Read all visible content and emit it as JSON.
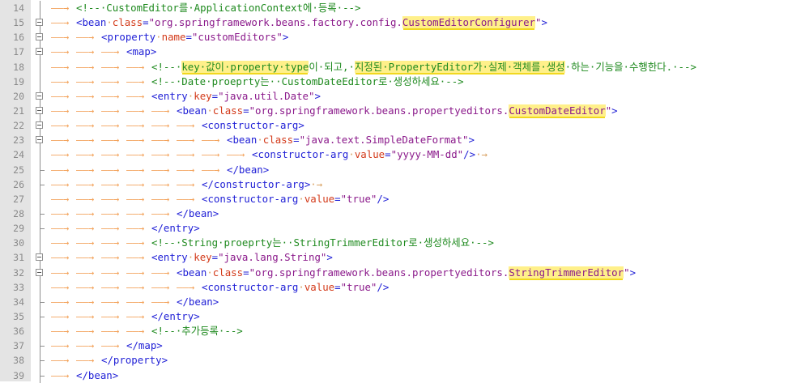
{
  "editor": {
    "lines": [
      {
        "num": "14",
        "fold": "line",
        "tabs": 1,
        "tokens": [
          {
            "t": "<!--",
            "c": "cmt"
          },
          {
            "t": "·CustomEditor를·ApplicationContext에·등록·",
            "c": "cmt"
          },
          {
            "t": "-->",
            "c": "cmt"
          }
        ]
      },
      {
        "num": "15",
        "fold": "box",
        "tabs": 1,
        "tokens": [
          {
            "t": "<bean",
            "c": "tag"
          },
          {
            "t": "·",
            "c": "wsdot"
          },
          {
            "t": "class",
            "c": "attr"
          },
          {
            "t": "=",
            "c": "tag"
          },
          {
            "t": "\"org.springframework.beans.factory.config.",
            "c": "val"
          },
          {
            "t": "CustomEditorConfigurer",
            "c": "val hl"
          },
          {
            "t": "\"",
            "c": "val"
          },
          {
            "t": ">",
            "c": "tag"
          }
        ]
      },
      {
        "num": "16",
        "fold": "box",
        "tabs": 2,
        "tokens": [
          {
            "t": "<property",
            "c": "tag"
          },
          {
            "t": "·",
            "c": "wsdot"
          },
          {
            "t": "name",
            "c": "attr"
          },
          {
            "t": "=",
            "c": "tag"
          },
          {
            "t": "\"customEditors\"",
            "c": "val"
          },
          {
            "t": ">",
            "c": "tag"
          }
        ]
      },
      {
        "num": "17",
        "fold": "box",
        "tabs": 3,
        "tokens": [
          {
            "t": "<map>",
            "c": "tag"
          }
        ]
      },
      {
        "num": "18",
        "fold": "line",
        "tabs": 4,
        "tokens": [
          {
            "t": "<!--·",
            "c": "cmt"
          },
          {
            "t": "key·값이·property·type",
            "c": "cmt hl"
          },
          {
            "t": "이·되고,·",
            "c": "cmt"
          },
          {
            "t": "지정된·PropertyEditor가·실제·객체를·생성",
            "c": "cmt hl"
          },
          {
            "t": "·하는·기능을·수행한다.·-->",
            "c": "cmt"
          }
        ]
      },
      {
        "num": "19",
        "fold": "line",
        "tabs": 4,
        "tokens": [
          {
            "t": "<!--·Date·proeprty는··CustomDateEditor로·생성하세요·-->",
            "c": "cmt"
          }
        ]
      },
      {
        "num": "20",
        "fold": "box",
        "tabs": 4,
        "tokens": [
          {
            "t": "<entry",
            "c": "tag"
          },
          {
            "t": "·",
            "c": "wsdot"
          },
          {
            "t": "key",
            "c": "attr"
          },
          {
            "t": "=",
            "c": "tag"
          },
          {
            "t": "\"java.util.Date\"",
            "c": "val"
          },
          {
            "t": ">",
            "c": "tag"
          }
        ]
      },
      {
        "num": "21",
        "fold": "box",
        "tabs": 5,
        "tokens": [
          {
            "t": "<bean",
            "c": "tag"
          },
          {
            "t": "·",
            "c": "wsdot"
          },
          {
            "t": "class",
            "c": "attr"
          },
          {
            "t": "=",
            "c": "tag"
          },
          {
            "t": "\"org.springframework.beans.propertyeditors.",
            "c": "val"
          },
          {
            "t": "CustomDateEditor",
            "c": "val hl"
          },
          {
            "t": "\"",
            "c": "val"
          },
          {
            "t": ">",
            "c": "tag"
          }
        ]
      },
      {
        "num": "22",
        "fold": "box",
        "tabs": 6,
        "tokens": [
          {
            "t": "<constructor-arg>",
            "c": "tag"
          }
        ]
      },
      {
        "num": "23",
        "fold": "box",
        "tabs": 7,
        "tokens": [
          {
            "t": "<bean",
            "c": "tag"
          },
          {
            "t": "·",
            "c": "wsdot"
          },
          {
            "t": "class",
            "c": "attr"
          },
          {
            "t": "=",
            "c": "tag"
          },
          {
            "t": "\"java.text.SimpleDateFormat\"",
            "c": "val"
          },
          {
            "t": ">",
            "c": "tag"
          }
        ]
      },
      {
        "num": "24",
        "fold": "line",
        "tabs": 8,
        "tokens": [
          {
            "t": "<constructor-arg",
            "c": "tag"
          },
          {
            "t": "·",
            "c": "wsdot"
          },
          {
            "t": "value",
            "c": "attr"
          },
          {
            "t": "=",
            "c": "tag"
          },
          {
            "t": "\"yyyy-MM-dd\"",
            "c": "val"
          },
          {
            "t": "/>",
            "c": "tag"
          },
          {
            "t": "·→",
            "c": "wsdot"
          }
        ]
      },
      {
        "num": "25",
        "fold": "end",
        "tabs": 7,
        "tokens": [
          {
            "t": "</bean>",
            "c": "tag"
          }
        ]
      },
      {
        "num": "26",
        "fold": "end",
        "tabs": 6,
        "tokens": [
          {
            "t": "</constructor-arg>",
            "c": "tag"
          },
          {
            "t": "·→",
            "c": "wsdot"
          }
        ]
      },
      {
        "num": "27",
        "fold": "line",
        "tabs": 6,
        "tokens": [
          {
            "t": "<constructor-arg",
            "c": "tag"
          },
          {
            "t": "·",
            "c": "wsdot"
          },
          {
            "t": "value",
            "c": "attr"
          },
          {
            "t": "=",
            "c": "tag"
          },
          {
            "t": "\"true\"",
            "c": "val"
          },
          {
            "t": "/>",
            "c": "tag"
          }
        ]
      },
      {
        "num": "28",
        "fold": "end",
        "tabs": 5,
        "tokens": [
          {
            "t": "</bean>",
            "c": "tag"
          }
        ]
      },
      {
        "num": "29",
        "fold": "end",
        "tabs": 4,
        "tokens": [
          {
            "t": "</entry>",
            "c": "tag"
          }
        ]
      },
      {
        "num": "30",
        "fold": "line",
        "tabs": 4,
        "tokens": [
          {
            "t": "<!--·String·proeprty는··StringTrimmerEditor로·생성하세요·-->",
            "c": "cmt"
          }
        ]
      },
      {
        "num": "31",
        "fold": "box",
        "tabs": 4,
        "tokens": [
          {
            "t": "<entry",
            "c": "tag"
          },
          {
            "t": "·",
            "c": "wsdot"
          },
          {
            "t": "key",
            "c": "attr"
          },
          {
            "t": "=",
            "c": "tag"
          },
          {
            "t": "\"java.lang.String\"",
            "c": "val"
          },
          {
            "t": ">",
            "c": "tag"
          }
        ]
      },
      {
        "num": "32",
        "fold": "box",
        "tabs": 5,
        "tokens": [
          {
            "t": "<bean",
            "c": "tag"
          },
          {
            "t": "·",
            "c": "wsdot"
          },
          {
            "t": "class",
            "c": "attr"
          },
          {
            "t": "=",
            "c": "tag"
          },
          {
            "t": "\"org.springframework.beans.propertyeditors.",
            "c": "val"
          },
          {
            "t": "StringTrimmerEditor",
            "c": "val hl"
          },
          {
            "t": "\"",
            "c": "val"
          },
          {
            "t": ">",
            "c": "tag"
          }
        ]
      },
      {
        "num": "33",
        "fold": "line",
        "tabs": 6,
        "tokens": [
          {
            "t": "<constructor-arg",
            "c": "tag"
          },
          {
            "t": "·",
            "c": "wsdot"
          },
          {
            "t": "value",
            "c": "attr"
          },
          {
            "t": "=",
            "c": "tag"
          },
          {
            "t": "\"true\"",
            "c": "val"
          },
          {
            "t": "/>",
            "c": "tag"
          }
        ]
      },
      {
        "num": "34",
        "fold": "end",
        "tabs": 5,
        "tokens": [
          {
            "t": "</bean>",
            "c": "tag"
          }
        ]
      },
      {
        "num": "35",
        "fold": "end",
        "tabs": 4,
        "tokens": [
          {
            "t": "</entry>",
            "c": "tag"
          }
        ]
      },
      {
        "num": "36",
        "fold": "line",
        "tabs": 4,
        "tokens": [
          {
            "t": "<!--·추가등록·-->",
            "c": "cmt"
          }
        ]
      },
      {
        "num": "37",
        "fold": "end",
        "tabs": 3,
        "tokens": [
          {
            "t": "</map>",
            "c": "tag"
          }
        ]
      },
      {
        "num": "38",
        "fold": "end",
        "tabs": 2,
        "tokens": [
          {
            "t": "</property>",
            "c": "tag"
          }
        ]
      },
      {
        "num": "39",
        "fold": "end",
        "tabs": 1,
        "tokens": [
          {
            "t": "</bean>",
            "c": "tag"
          }
        ]
      }
    ]
  }
}
